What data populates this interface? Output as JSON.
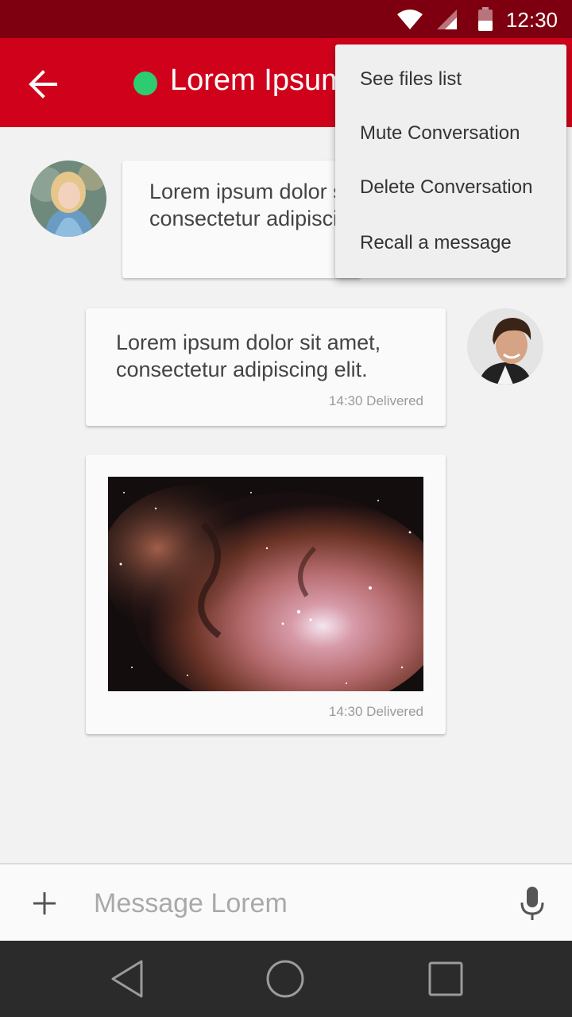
{
  "status_bar": {
    "time": "12:30",
    "icons": [
      "wifi-icon",
      "cell-signal-icon",
      "battery-icon"
    ]
  },
  "app_bar": {
    "title": "Lorem Ipsum",
    "status_color": "#2ecc71",
    "background": "#d0021b"
  },
  "overflow_menu": {
    "items": [
      {
        "label": "See files list"
      },
      {
        "label": "Mute Conversation"
      },
      {
        "label": "Delete Conversation"
      },
      {
        "label": "Recall a message"
      }
    ]
  },
  "messages": [
    {
      "sender": "contact",
      "text_line1": "Lorem ipsum dolor sit amet,",
      "text_line2": "consectetur adipiscing elit."
    },
    {
      "sender": "me",
      "text_line1": "Lorem ipsum dolor sit amet,",
      "text_line2": "consectetur adipiscing elit.",
      "meta": "14:30 Delivered"
    },
    {
      "sender": "me",
      "type": "image",
      "meta": "14:30 Delivered"
    }
  ],
  "composer": {
    "placeholder": "Message Lorem"
  },
  "nav_bar": {
    "icons": [
      "back-nav-icon",
      "home-nav-icon",
      "recents-nav-icon"
    ]
  }
}
